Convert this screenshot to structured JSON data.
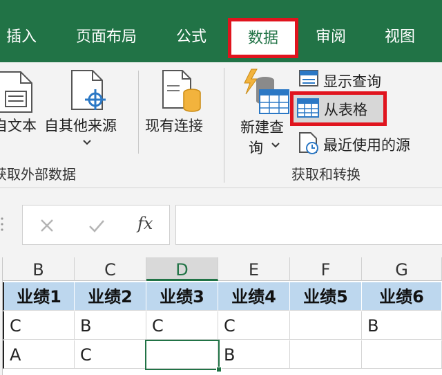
{
  "ribbon_tabs": {
    "insert": "插入",
    "page_layout": "页面布局",
    "formulas": "公式",
    "data": "数据",
    "review": "审阅",
    "view": "视图"
  },
  "get_external_data": {
    "from_text": "自文本",
    "from_other_sources": "自其他来源",
    "existing_connections": "现有连接",
    "group_label": "获取外部数据"
  },
  "get_and_transform": {
    "new_query_line1": "新建查",
    "new_query_line2": "询",
    "show_queries": "显示查询",
    "from_table": "从表格",
    "recent_sources": "最近使用的源",
    "group_label": "获取和转换"
  },
  "formula_bar": {
    "fx_label": "fx"
  },
  "grid": {
    "columns": [
      "B",
      "C",
      "D",
      "E",
      "F",
      "G"
    ],
    "selected_column": "D",
    "header_row": [
      "业绩1",
      "业绩2",
      "业绩3",
      "业绩4",
      "业绩5",
      "业绩6"
    ],
    "rows": [
      [
        "C",
        "B",
        "C",
        "C",
        "",
        "B"
      ],
      [
        "A",
        "C",
        "",
        "B",
        "",
        ""
      ]
    ],
    "header_fill": "#bdd7ee"
  },
  "colors": {
    "accent": "#217346",
    "highlight_box": "#e0141e"
  }
}
